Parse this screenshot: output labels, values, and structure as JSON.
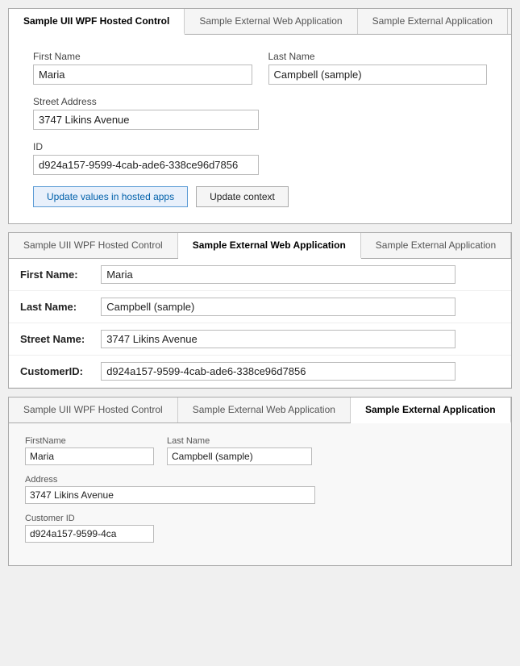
{
  "panel1": {
    "tabs": [
      {
        "label": "Sample UII WPF Hosted Control",
        "active": true
      },
      {
        "label": "Sample External Web Application",
        "active": false
      },
      {
        "label": "Sample External Application",
        "active": false
      }
    ],
    "fields": {
      "first_name_label": "First Name",
      "first_name_value": "Maria",
      "last_name_label": "Last Name",
      "last_name_value": "Campbell (sample)",
      "street_label": "Street Address",
      "street_value": "3747 Likins Avenue",
      "id_label": "ID",
      "id_value": "d924a157-9599-4cab-ade6-338ce96d7856"
    },
    "buttons": {
      "update_hosted": "Update values in hosted apps",
      "update_context": "Update context"
    }
  },
  "panel2": {
    "tabs": [
      {
        "label": "Sample UII WPF Hosted Control",
        "active": false
      },
      {
        "label": "Sample External Web Application",
        "active": true
      },
      {
        "label": "Sample External Application",
        "active": false
      }
    ],
    "rows": [
      {
        "label": "First Name:",
        "value": "Maria"
      },
      {
        "label": "Last Name:",
        "value": "Campbell (sample)"
      },
      {
        "label": "Street Name:",
        "value": "3747 Likins Avenue"
      },
      {
        "label": "CustomerID:",
        "value": "d924a157-9599-4cab-ade6-338ce96d7856"
      }
    ]
  },
  "panel3": {
    "tabs": [
      {
        "label": "Sample UII WPF Hosted Control",
        "active": false
      },
      {
        "label": "Sample External Web Application",
        "active": false
      },
      {
        "label": "Sample External Application",
        "active": true
      }
    ],
    "fields": {
      "first_name_label": "FirstName",
      "first_name_value": "Maria",
      "last_name_label": "Last Name",
      "last_name_value": "Campbell (sample)",
      "address_label": "Address",
      "address_value": "3747 Likins Avenue",
      "customer_id_label": "Customer ID",
      "customer_id_value": "d924a157-9599-4ca"
    }
  }
}
